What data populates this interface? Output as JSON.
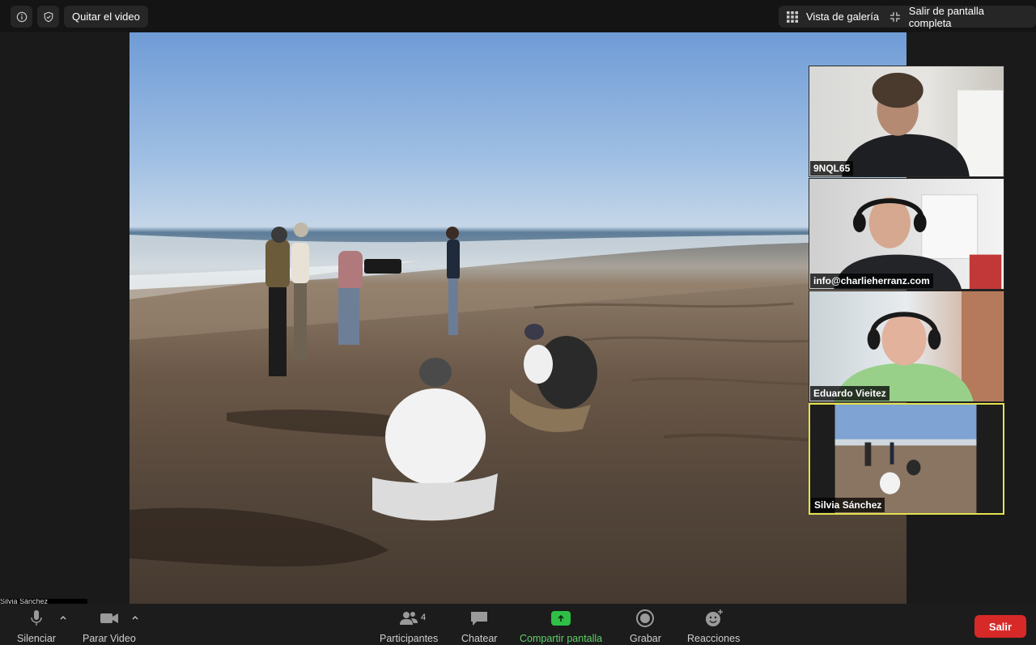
{
  "topbar": {
    "info_icon": "info-icon",
    "security_icon": "shield-check-icon",
    "hide_video_label": "Quitar el video",
    "gallery_label": "Vista de galería",
    "exit_fullscreen_label": "Salir de pantalla completa"
  },
  "main": {
    "self_label": "Silvia Sánchez"
  },
  "participants": [
    {
      "name": "9NQL65"
    },
    {
      "name": "info@charlieherranz.com"
    },
    {
      "name": "Eduardo Vieitez"
    },
    {
      "name": "Silvia Sánchez",
      "active": true
    }
  ],
  "toolbar": {
    "mute_label": "Silenciar",
    "video_label": "Parar Video",
    "participants_label": "Participantes",
    "participants_count": "4",
    "chat_label": "Chatear",
    "share_label": "Compartir pantalla",
    "record_label": "Grabar",
    "reactions_label": "Reacciones",
    "leave_label": "Salir"
  },
  "colors": {
    "share_green": "#2fbf45",
    "leave_red": "#d82929",
    "active_border": "#e4e24e"
  }
}
